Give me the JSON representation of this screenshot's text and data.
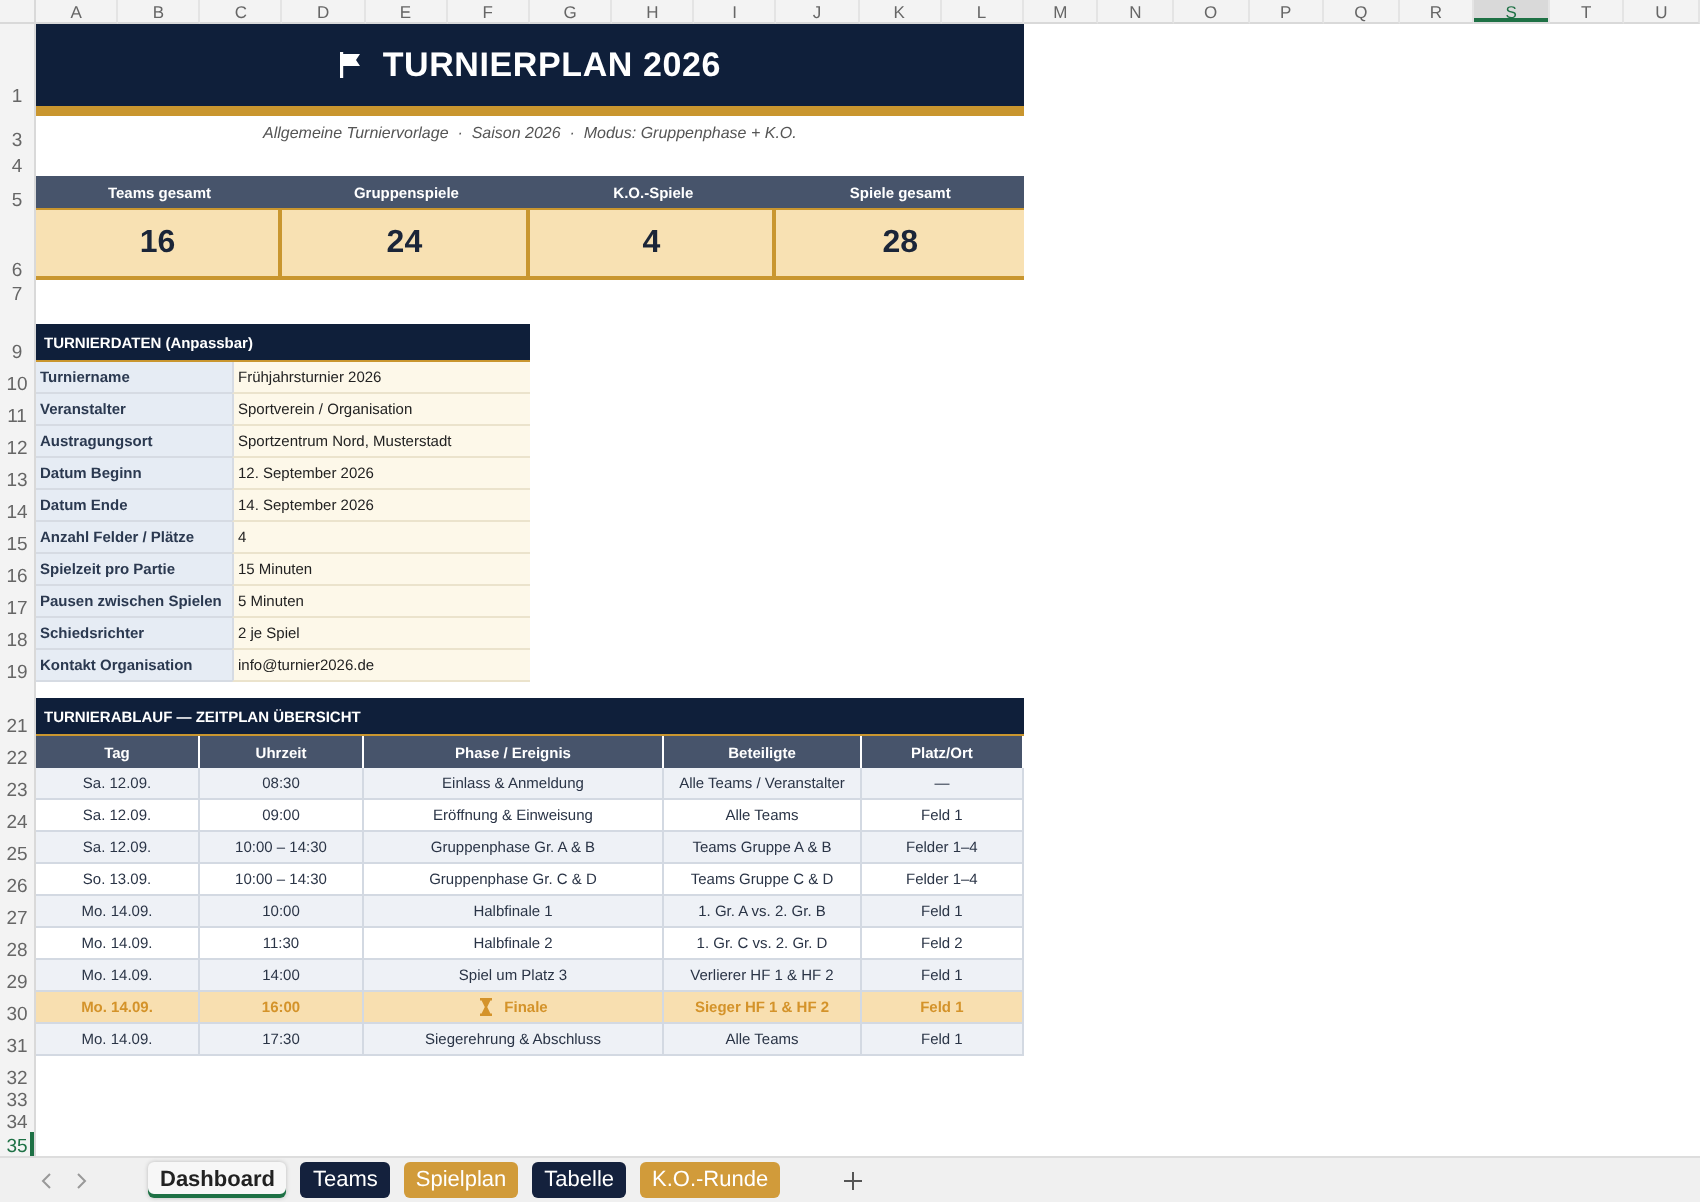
{
  "column_headers": [
    {
      "label": "A",
      "selected": false
    },
    {
      "label": "B",
      "selected": false
    },
    {
      "label": "C",
      "selected": false
    },
    {
      "label": "D",
      "selected": false
    },
    {
      "label": "E",
      "selected": false
    },
    {
      "label": "F",
      "selected": false
    },
    {
      "label": "G",
      "selected": false
    },
    {
      "label": "H",
      "selected": false
    },
    {
      "label": "I",
      "selected": false
    },
    {
      "label": "J",
      "selected": false
    },
    {
      "label": "K",
      "selected": false
    },
    {
      "label": "L",
      "selected": false
    },
    {
      "label": "M",
      "selected": false
    },
    {
      "label": "N",
      "selected": false
    },
    {
      "label": "O",
      "selected": false
    },
    {
      "label": "P",
      "selected": false
    },
    {
      "label": "Q",
      "selected": false
    },
    {
      "label": "R",
      "selected": false
    },
    {
      "label": "S",
      "selected": true
    },
    {
      "label": "T",
      "selected": false
    },
    {
      "label": "U",
      "selected": false
    }
  ],
  "row_headers": [
    {
      "label": "1",
      "selected": false
    },
    {
      "label": "3",
      "selected": false
    },
    {
      "label": "4",
      "selected": false
    },
    {
      "label": "5",
      "selected": false
    },
    {
      "label": "6",
      "selected": false
    },
    {
      "label": "7",
      "selected": false
    },
    {
      "label": "9",
      "selected": false
    },
    {
      "label": "10",
      "selected": false
    },
    {
      "label": "11",
      "selected": false
    },
    {
      "label": "12",
      "selected": false
    },
    {
      "label": "13",
      "selected": false
    },
    {
      "label": "14",
      "selected": false
    },
    {
      "label": "15",
      "selected": false
    },
    {
      "label": "16",
      "selected": false
    },
    {
      "label": "17",
      "selected": false
    },
    {
      "label": "18",
      "selected": false
    },
    {
      "label": "19",
      "selected": false
    },
    {
      "label": "21",
      "selected": false
    },
    {
      "label": "22",
      "selected": false
    },
    {
      "label": "23",
      "selected": false
    },
    {
      "label": "24",
      "selected": false
    },
    {
      "label": "25",
      "selected": false
    },
    {
      "label": "26",
      "selected": false
    },
    {
      "label": "27",
      "selected": false
    },
    {
      "label": "28",
      "selected": false
    },
    {
      "label": "29",
      "selected": false
    },
    {
      "label": "30",
      "selected": false
    },
    {
      "label": "31",
      "selected": false
    },
    {
      "label": "32",
      "selected": false
    },
    {
      "label": "33",
      "selected": false
    },
    {
      "label": "34",
      "selected": false
    },
    {
      "label": "35",
      "selected": true
    }
  ],
  "banner": {
    "title": "TURNIERPLAN 2026"
  },
  "subtitle": "Allgemeine Turniervorlage  ·  Saison 2026  ·  Modus: Gruppenphase + K.O.",
  "kpis": [
    {
      "label": "Teams gesamt",
      "value": "16"
    },
    {
      "label": "Gruppenspiele",
      "value": "24"
    },
    {
      "label": "K.O.-Spiele",
      "value": "4"
    },
    {
      "label": "Spiele gesamt",
      "value": "28"
    }
  ],
  "details": {
    "title": "TURNIERDATEN (Anpassbar)",
    "rows": [
      {
        "label": "Turniername",
        "value": "Frühjahrsturnier 2026"
      },
      {
        "label": "Veranstalter",
        "value": "Sportverein / Organisation"
      },
      {
        "label": "Austragungsort",
        "value": "Sportzentrum Nord, Musterstadt"
      },
      {
        "label": "Datum Beginn",
        "value": "12. September 2026"
      },
      {
        "label": "Datum Ende",
        "value": "14. September 2026"
      },
      {
        "label": "Anzahl Felder / Plätze",
        "value": "4"
      },
      {
        "label": "Spielzeit pro Partie",
        "value": "15 Minuten"
      },
      {
        "label": "Pausen zwischen Spielen",
        "value": "5 Minuten"
      },
      {
        "label": "Schiedsrichter",
        "value": "2 je Spiel"
      },
      {
        "label": "Kontakt Organisation",
        "value": "info@turnier2026.de"
      }
    ]
  },
  "schedule": {
    "title": "TURNIERABLAUF — ZEITPLAN ÜBERSICHT",
    "columns": [
      "Tag",
      "Uhrzeit",
      "Phase / Ereignis",
      "Beteiligte",
      "Platz/Ort"
    ],
    "rows": [
      {
        "cells": [
          "Sa. 12.09.",
          "08:30",
          "Einlass & Anmeldung",
          "Alle Teams / Veranstalter",
          "—"
        ],
        "highlighted": false
      },
      {
        "cells": [
          "Sa. 12.09.",
          "09:00",
          "Eröffnung & Einweisung",
          "Alle Teams",
          "Feld 1"
        ],
        "highlighted": false
      },
      {
        "cells": [
          "Sa. 12.09.",
          "10:00 – 14:30",
          "Gruppenphase Gr. A & B",
          "Teams Gruppe A & B",
          "Felder 1–4"
        ],
        "highlighted": false
      },
      {
        "cells": [
          "So. 13.09.",
          "10:00 – 14:30",
          "Gruppenphase Gr. C & D",
          "Teams Gruppe C & D",
          "Felder 1–4"
        ],
        "highlighted": false
      },
      {
        "cells": [
          "Mo. 14.09.",
          "10:00",
          "Halbfinale 1",
          "1. Gr. A vs. 2. Gr. B",
          "Feld 1"
        ],
        "highlighted": false
      },
      {
        "cells": [
          "Mo. 14.09.",
          "11:30",
          "Halbfinale 2",
          "1. Gr. C vs. 2. Gr. D",
          "Feld 2"
        ],
        "highlighted": false
      },
      {
        "cells": [
          "Mo. 14.09.",
          "14:00",
          "Spiel um Platz 3",
          "Verlierer HF 1 & HF 2",
          "Feld 1"
        ],
        "highlighted": false
      },
      {
        "cells": [
          "Mo. 14.09.",
          "16:00",
          "Finale",
          "Sieger HF 1 & HF 2",
          "Feld 1"
        ],
        "highlighted": true
      },
      {
        "cells": [
          "Mo. 14.09.",
          "17:30",
          "Siegerehrung & Abschluss",
          "Alle Teams",
          "Feld 1"
        ],
        "highlighted": false
      }
    ]
  },
  "sheet_tabs": [
    {
      "label": "Dashboard",
      "selected": true,
      "color": "#f7f7f7"
    },
    {
      "label": "Teams",
      "selected": false,
      "color": "#14213d"
    },
    {
      "label": "Spielplan",
      "selected": false,
      "color": "#d19b3a"
    },
    {
      "label": "Tabelle",
      "selected": false,
      "color": "#14213d"
    },
    {
      "label": "K.O.-Runde",
      "selected": false,
      "color": "#d19b3a"
    }
  ]
}
